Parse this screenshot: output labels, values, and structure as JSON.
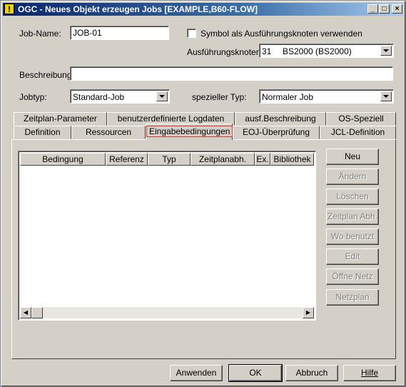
{
  "window": {
    "title": "OGC - Neues Objekt erzeugen Jobs [EXAMPLE,B60-FLOW]",
    "title_icon": "!",
    "controls": {
      "minimize": "_",
      "maximize": "□",
      "close": "×"
    }
  },
  "form": {
    "jobname_label": "Job-Name:",
    "jobname_value": "JOB-01",
    "symbol_checkbox_label": "Symbol als Ausführungsknoten verwenden",
    "symbol_checked": false,
    "node_label": "Ausführungsknoten:",
    "node_number": "31",
    "node_value": "BS2000 (BS2000)",
    "desc_label": "Beschreibung:",
    "desc_value": "",
    "jobtype_label": "Jobtyp:",
    "jobtype_value": "Standard-Job",
    "spectype_label": "spezieller Typ:",
    "spectype_value": "Normaler Job"
  },
  "tabs": {
    "row1": [
      "Zeitplan-Parameter",
      "benutzerdefinierte Logdaten",
      "ausf.Beschreibung",
      "OS-Speziell"
    ],
    "row2": [
      "Definition",
      "Ressourcen",
      "Eingabebedingungen",
      "EOJ-Überprüfung",
      "JCL-Definition"
    ],
    "active": "Eingabebedingungen"
  },
  "list": {
    "columns": [
      "Bedingung",
      "Referenz",
      "Typ",
      "Zeitplanabh.",
      "Ex.",
      "Bibliothek"
    ],
    "rows": []
  },
  "side_buttons": [
    {
      "label": "Neu",
      "enabled": true
    },
    {
      "label": "Ändern",
      "enabled": false
    },
    {
      "label": "Löschen",
      "enabled": false
    },
    {
      "label": "Zeitplan Abh.",
      "enabled": false
    },
    {
      "label": "Wo benutzt",
      "enabled": false
    },
    {
      "label": "Edit",
      "enabled": false
    },
    {
      "label": "Öffne Netz",
      "enabled": false
    },
    {
      "label": "Netzplan",
      "enabled": false
    }
  ],
  "bottom_buttons": {
    "apply": "Anwenden",
    "ok": "OK",
    "cancel": "Abbruch",
    "help": "Hilfe"
  },
  "scroll": {
    "left": "◀",
    "right": "▶"
  }
}
